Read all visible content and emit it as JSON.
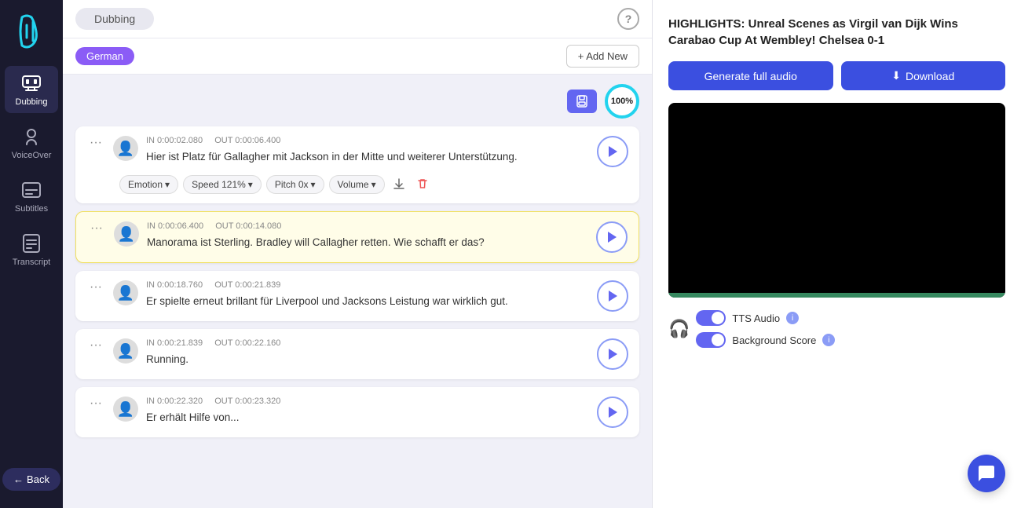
{
  "sidebar": {
    "items": [
      {
        "id": "dubbing",
        "label": "Dubbing",
        "active": true
      },
      {
        "id": "voiceover",
        "label": "VoiceOver",
        "active": false
      },
      {
        "id": "subtitles",
        "label": "Subtitles",
        "active": false
      },
      {
        "id": "transcript",
        "label": "Transcript",
        "active": false
      }
    ],
    "back_label": "Back"
  },
  "top_bar": {
    "tab_label": "Dubbing",
    "help_icon": "?"
  },
  "lang_bar": {
    "language": "German",
    "add_new_label": "+ Add New"
  },
  "tracks": {
    "progress": "100%",
    "items": [
      {
        "id": 1,
        "in_time": "IN 0:00:02.080",
        "out_time": "OUT 0:00:06.400",
        "text": "Hier ist Platz für Gallagher mit Jackson in der Mitte und weiterer Unterstützung.",
        "active": false,
        "show_controls": true,
        "emotion_label": "Emotion",
        "speed_label": "Speed 121%",
        "pitch_label": "Pitch 0x",
        "volume_label": "Volume"
      },
      {
        "id": 2,
        "in_time": "IN 0:00:06.400",
        "out_time": "OUT 0:00:14.080",
        "text": "Manorama ist Sterling. Bradley will Callagher retten. Wie schafft er das?",
        "active": true,
        "show_controls": false
      },
      {
        "id": 3,
        "in_time": "IN 0:00:18.760",
        "out_time": "OUT 0:00:21.839",
        "text": "Er spielte erneut brillant für Liverpool und Jacksons Leistung war wirklich gut.",
        "active": false,
        "show_controls": false
      },
      {
        "id": 4,
        "in_time": "IN 0:00:21.839",
        "out_time": "OUT 0:00:22.160",
        "text": "Running.",
        "active": false,
        "show_controls": false
      },
      {
        "id": 5,
        "in_time": "IN 0:00:22.320",
        "out_time": "OUT 0:00:23.320",
        "text": "Er erhält Hilfe von...",
        "active": false,
        "show_controls": false
      }
    ]
  },
  "right_panel": {
    "title": "HIGHLIGHTS: Unreal Scenes as Virgil van Dijk Wins Carabao Cup At Wembley! Chelsea 0-1",
    "generate_btn": "Generate full audio",
    "download_btn": "Download",
    "tts_audio_label": "TTS Audio",
    "background_score_label": "Background Score"
  }
}
